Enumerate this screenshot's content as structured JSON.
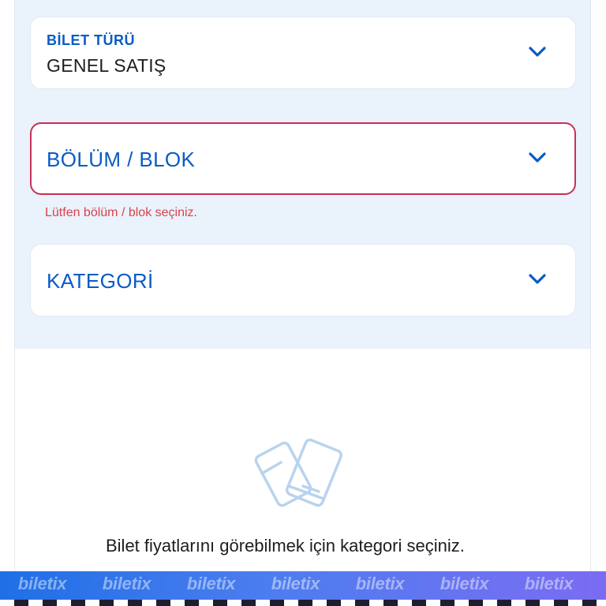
{
  "form": {
    "ticket_type": {
      "label": "BİLET TÜRÜ",
      "value": "GENEL SATIŞ",
      "icon": "chevron-down-icon"
    },
    "section": {
      "placeholder": "BÖLÜM / BLOK",
      "error": "Lütfen bölüm / blok seçiniz.",
      "icon": "chevron-down-icon"
    },
    "category": {
      "placeholder": "KATEGORİ",
      "icon": "chevron-down-icon"
    }
  },
  "empty_state": {
    "icon": "tickets-icon",
    "message": "Bilet fiyatlarını görebilmek için kategori seçiniz."
  },
  "banner": {
    "watermark": [
      "biletix",
      "biletix",
      "biletix",
      "biletix",
      "biletix",
      "biletix",
      "biletix"
    ]
  },
  "colors": {
    "accent": "#0a5bc4",
    "error": "#c73155",
    "panel_bg": "#eaf2fb"
  }
}
